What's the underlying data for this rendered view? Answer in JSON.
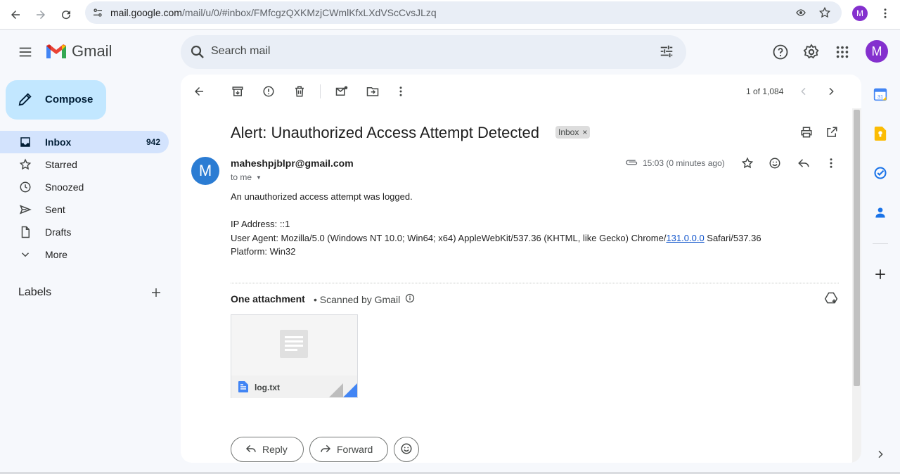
{
  "browser": {
    "url_host": "mail.google.com",
    "url_path": "/mail/u/0/#inbox/FMfcgzQXKMzjCWmlKfxLXdVScCvsJLzq",
    "profile_initial": "M"
  },
  "header": {
    "app_name": "Gmail",
    "search_placeholder": "Search mail",
    "account_initial": "M"
  },
  "sidebar": {
    "compose_label": "Compose",
    "items": [
      {
        "label": "Inbox",
        "count": "942",
        "icon": "inbox-icon",
        "active": true
      },
      {
        "label": "Starred",
        "count": "",
        "icon": "star-icon"
      },
      {
        "label": "Snoozed",
        "count": "",
        "icon": "clock-icon"
      },
      {
        "label": "Sent",
        "count": "",
        "icon": "send-icon"
      },
      {
        "label": "Drafts",
        "count": "",
        "icon": "draft-icon"
      },
      {
        "label": "More",
        "count": "",
        "icon": "chevron-down-icon"
      }
    ],
    "labels_title": "Labels"
  },
  "toolbar": {
    "pager": "1 of 1,084"
  },
  "message": {
    "subject": "Alert: Unauthorized Access Attempt Detected",
    "label_chip": "Inbox",
    "sender_initial": "M",
    "sender": "maheshpjblpr@gmail.com",
    "recipient": "to me",
    "timestamp": "15:03 (0 minutes ago)",
    "body": {
      "line1": "An unauthorized access attempt was logged.",
      "ip": "IP Address: ::1",
      "ua_prefix": "User Agent: Mozilla/5.0 (Windows NT 10.0; Win64; x64) AppleWebKit/537.36 (KHTML, like Gecko) Chrome/",
      "ua_link": "131.0.0.0",
      "ua_suffix": " Safari/537.36",
      "platform": "Platform: Win32"
    },
    "attachments_title": "One attachment",
    "scanned_text": "• Scanned by Gmail",
    "attachment_name": "log.txt"
  },
  "actions": {
    "reply": "Reply",
    "forward": "Forward"
  },
  "colors": {
    "accent": "#c2e7ff",
    "active_nav": "#d3e3fd",
    "avatar_purple": "#8430ce",
    "sender_avatar": "#2b7cd3",
    "link": "#1155cc"
  }
}
